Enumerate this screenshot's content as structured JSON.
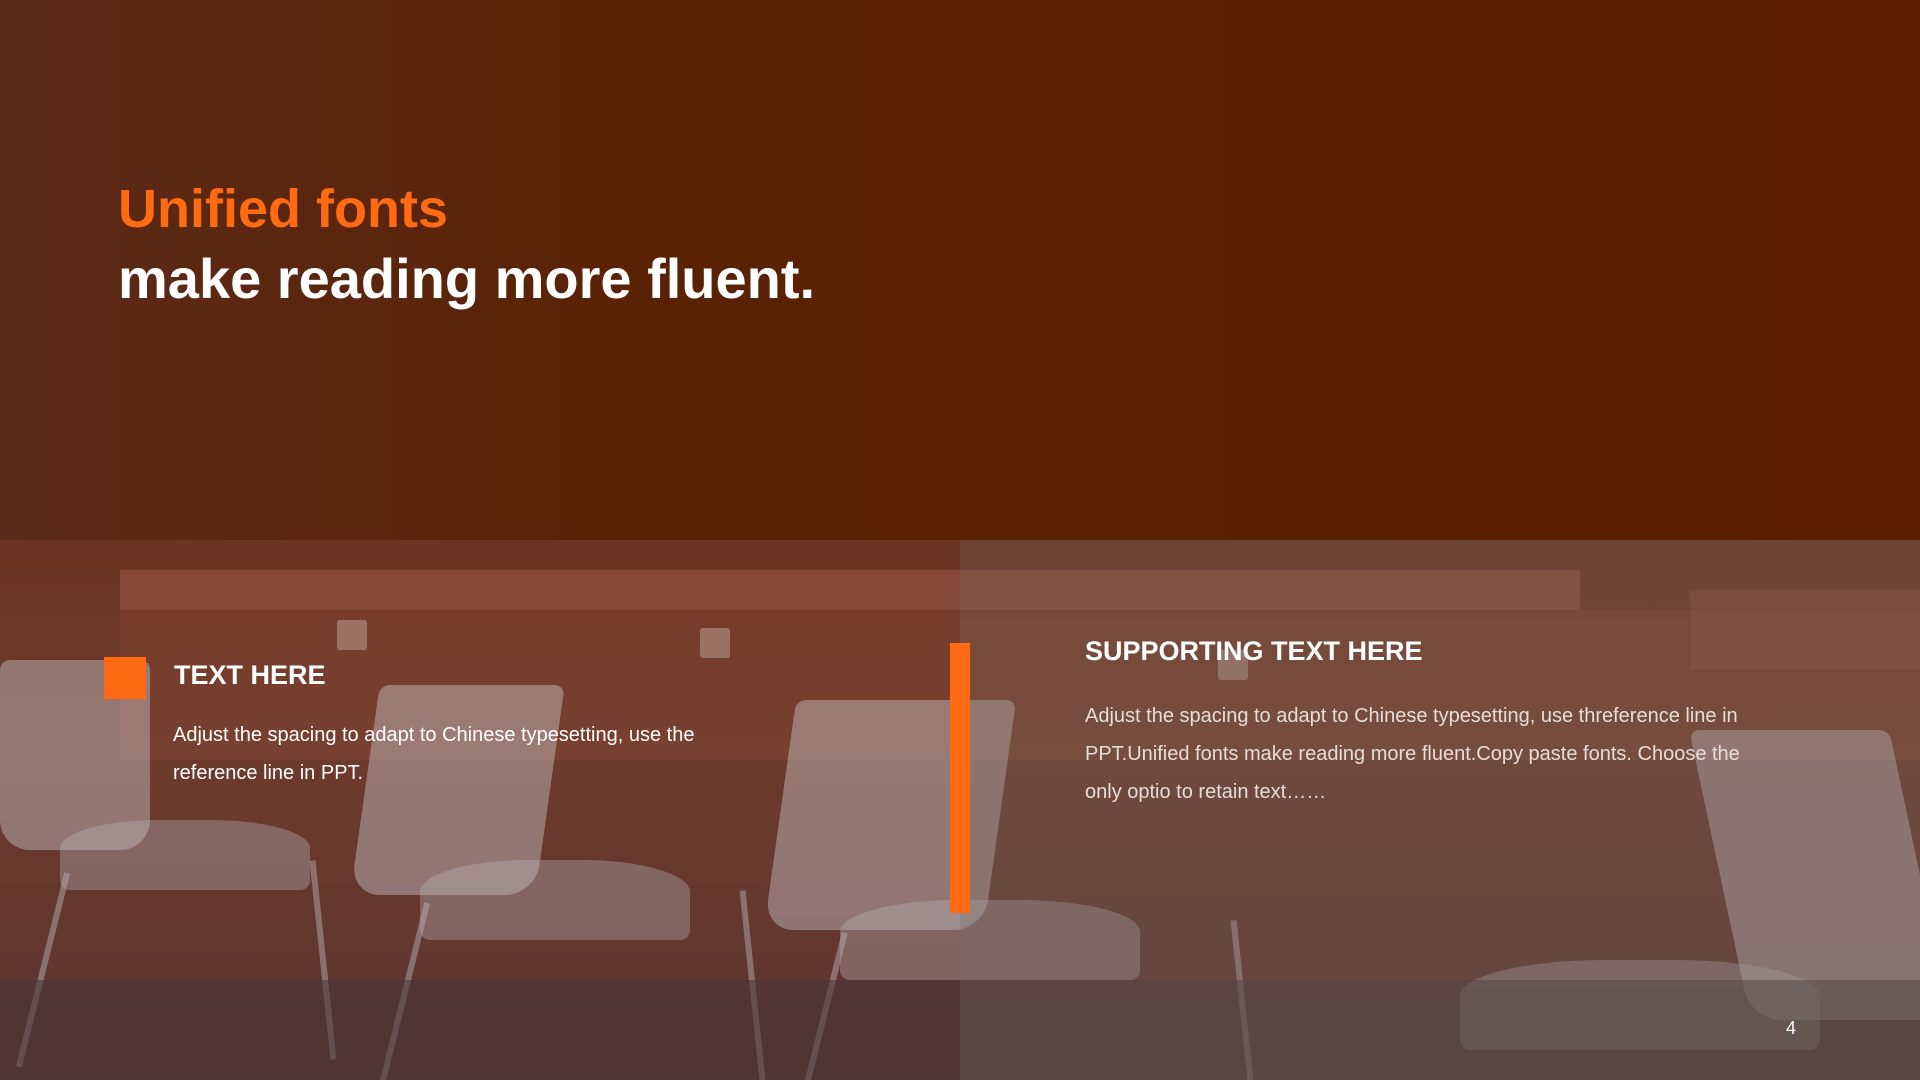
{
  "slide": {
    "title_accent": "Unified fonts",
    "title_main": "make reading more fluent.",
    "left_block": {
      "heading": "TEXT HERE",
      "body": "Adjust the spacing to adapt to Chinese typesetting, use the reference line in PPT."
    },
    "right_block": {
      "heading": "SUPPORTING TEXT HERE",
      "body": "Adjust the spacing to adapt to Chinese typesetting, use threference line in PPT.Unified fonts make reading more fluent.Copy paste fonts. Choose the only optio to retain text……"
    },
    "page_number": "4"
  },
  "colors": {
    "accent": "#ff6a13",
    "background": "#5b1f00",
    "text": "#ffffff"
  }
}
